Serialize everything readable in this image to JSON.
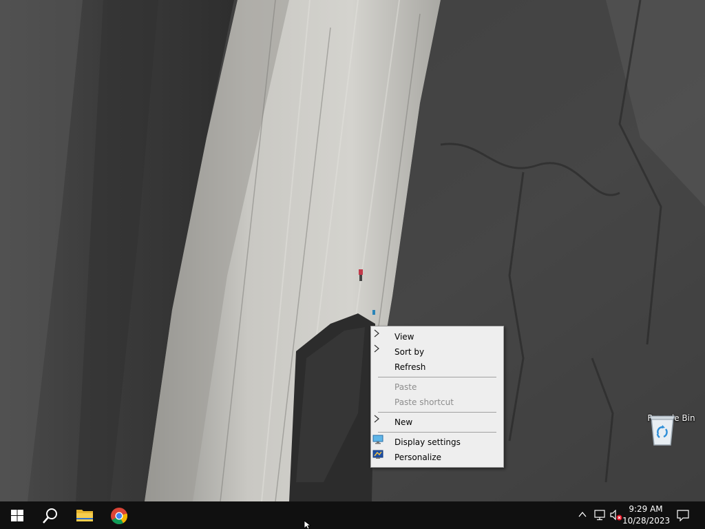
{
  "desktop": {
    "icons": [
      {
        "label": "Recycle Bin",
        "icon": "recycle-bin-icon"
      }
    ]
  },
  "context_menu": {
    "items": [
      {
        "label": "View",
        "has_submenu": true,
        "enabled": true
      },
      {
        "label": "Sort by",
        "has_submenu": true,
        "enabled": true
      },
      {
        "label": "Refresh",
        "has_submenu": false,
        "enabled": true
      },
      {
        "label": "Paste",
        "has_submenu": false,
        "enabled": false
      },
      {
        "label": "Paste shortcut",
        "has_submenu": false,
        "enabled": false
      },
      {
        "label": "New",
        "has_submenu": true,
        "enabled": true
      },
      {
        "label": "Display settings",
        "icon": "display-settings-icon",
        "enabled": true
      },
      {
        "label": "Personalize",
        "icon": "personalize-icon",
        "enabled": true
      }
    ]
  },
  "taskbar": {
    "pinned": [
      {
        "icon": "windows-start-icon"
      },
      {
        "icon": "search-icon"
      },
      {
        "icon": "file-explorer-icon"
      },
      {
        "icon": "chrome-icon"
      }
    ],
    "tray": {
      "time": "9:29 AM",
      "date": "10/28/2023",
      "icons": [
        "chevron-up-icon",
        "network-icon",
        "volume-muted-icon",
        "notification-icon"
      ]
    }
  },
  "colors": {
    "taskbar_bg": "#101010",
    "menu_bg": "#eeeeee",
    "menu_disabled_text": "#8d8d8d",
    "accent_blue": "#1e90ff"
  }
}
